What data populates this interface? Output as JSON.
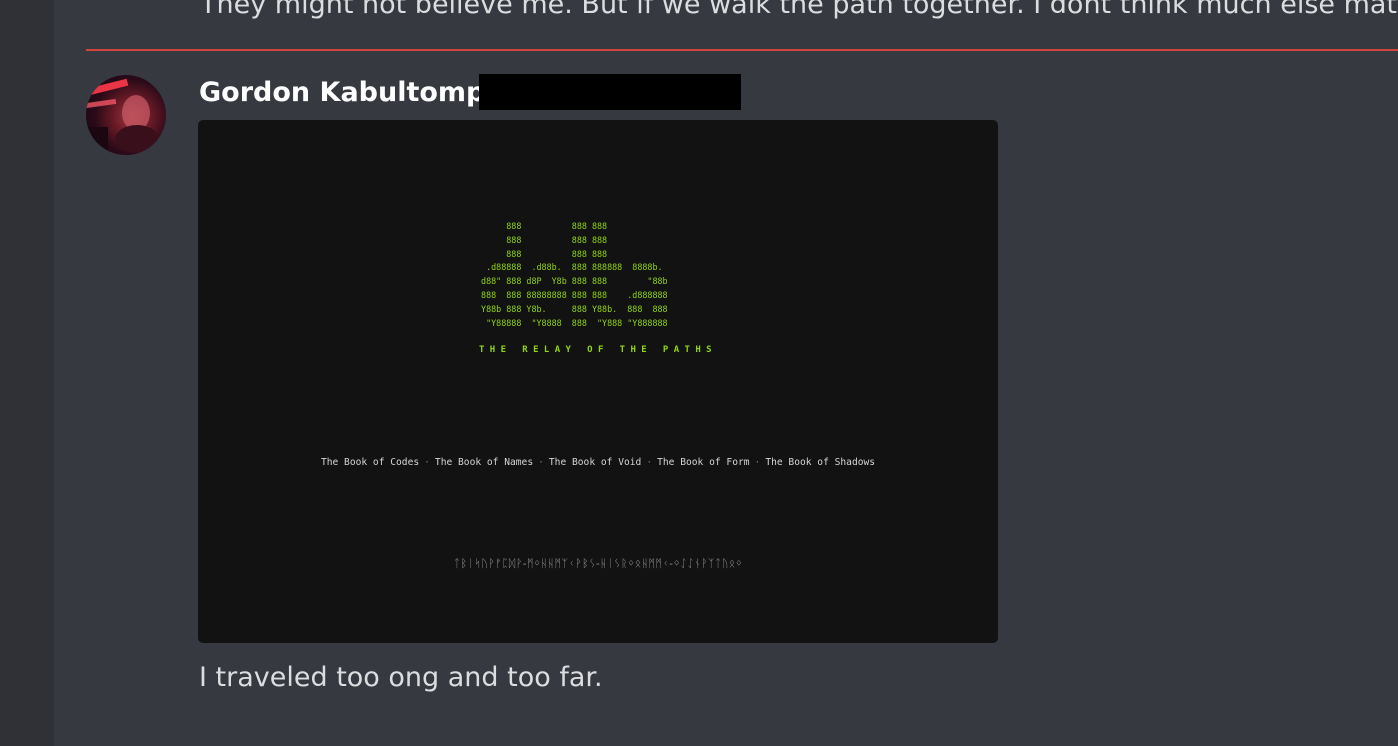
{
  "previous_message": {
    "text": "They might not believe me. But if we walk the path together. I dont think much else matters."
  },
  "message": {
    "author": "Gordon Kabultompp",
    "text": "I traveled too ong and too far."
  },
  "embed": {
    "ascii_logo": "      888          888 888\n      888          888 888\n      888          888 888\n  .d88888  .d88b.  888 888888  8888b.\n d88\" 888 d8P  Y8b 888 888        \"88b\n 888  888 88888888 888 888    .d888888\n Y88b 888 Y8b.     888 Y88b.  888  888\n  \"Y88888  \"Y8888  888  \"Y888 \"Y888888",
    "title": "THE RELAY OF THE PATHS",
    "books": [
      "The Book of Codes",
      "The Book of Names",
      "The Book of Void",
      "The Book of Form",
      "The Book of Shadows"
    ],
    "separator": "·",
    "runes": "ᛏᛒᛁᛋᚢᚹᚠᛈᛞᚹ-ᛗᛜᚺᚺᛗᛉᚲᚹᛒᛊ-ᚺᛁᛊᚱᛜᛟᚺᛗᛗᚲ-ᛜᛇᛇᚾᚹᛉᛏᚢᛟᛜ"
  },
  "colors": {
    "background": "#36393f",
    "rail": "#2f3136",
    "divider": "#d0453e",
    "embed_bg": "#121212",
    "ascii_green": "#8fd60f"
  }
}
